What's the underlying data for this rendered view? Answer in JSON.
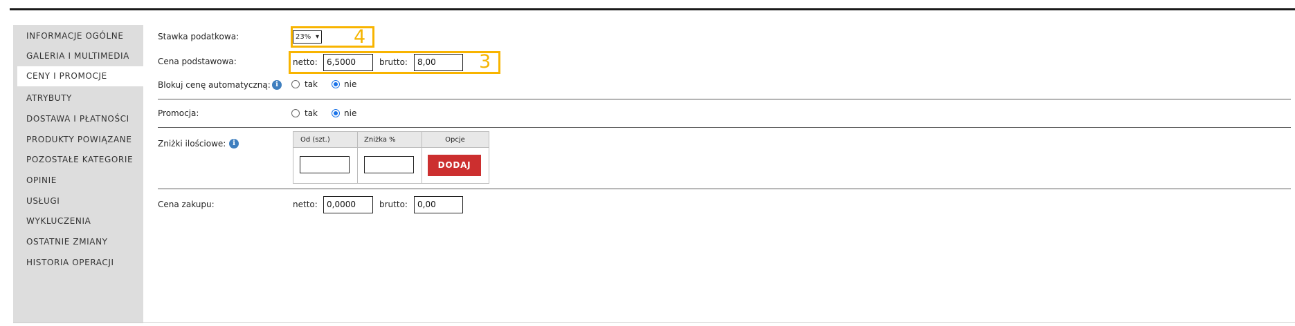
{
  "sidebar": {
    "items": [
      {
        "label": "INFORMACJE OGÓLNE"
      },
      {
        "label": "GALERIA I MULTIMEDIA"
      },
      {
        "label": "CENY I PROMOCJE"
      },
      {
        "label": "ATRYBUTY"
      },
      {
        "label": "DOSTAWA I PŁATNOŚCI"
      },
      {
        "label": "PRODUKTY POWIĄZANE"
      },
      {
        "label": "POZOSTAŁE KATEGORIE"
      },
      {
        "label": "OPINIE"
      },
      {
        "label": "USŁUGI"
      },
      {
        "label": "WYKLUCZENIA"
      },
      {
        "label": "OSTATNIE ZMIANY"
      },
      {
        "label": "HISTORIA OPERACJI"
      }
    ],
    "active_index": 2
  },
  "form": {
    "vat": {
      "label": "Stawka podatkowa:",
      "value": "23%",
      "annotation": "4"
    },
    "base_price": {
      "label": "Cena podstawowa:",
      "netto_label": "netto:",
      "netto_value": "6,5000",
      "brutto_label": "brutto:",
      "brutto_value": "8,00",
      "annotation": "3"
    },
    "block_price": {
      "label": "Blokuj cenę automatyczną:",
      "yes": "tak",
      "no": "nie",
      "selected": "nie"
    },
    "promotion": {
      "label": "Promocja:",
      "yes": "tak",
      "no": "nie",
      "selected": "nie"
    },
    "discounts": {
      "label": "Zniżki ilościowe:",
      "columns": [
        "Od (szt.)",
        "Zniżka %",
        "Opcje"
      ],
      "add_button": "DODAJ"
    },
    "purchase_price": {
      "label": "Cena zakupu:",
      "netto_label": "netto:",
      "netto_value": "0,0000",
      "brutto_label": "brutto:",
      "brutto_value": "0,00"
    }
  },
  "colors": {
    "highlight": "#f8b400",
    "accent": "#cc2f2f",
    "radio": "#1a73e8",
    "sidebar_bg": "#dddddd"
  }
}
